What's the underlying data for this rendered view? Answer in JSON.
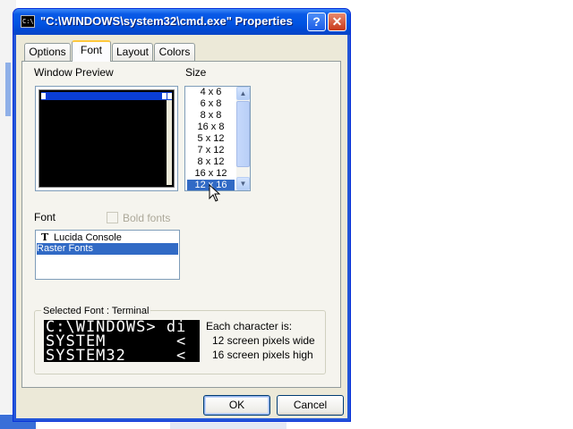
{
  "window": {
    "title": "\"C:\\WINDOWS\\system32\\cmd.exe\" Properties",
    "icon_text": "C:\\",
    "help_label": "?",
    "close_label": "✕"
  },
  "tabs": [
    {
      "label": "Options"
    },
    {
      "label": "Font"
    },
    {
      "label": "Layout"
    },
    {
      "label": "Colors"
    }
  ],
  "font_tab": {
    "window_preview_label": "Window Preview",
    "size_label": "Size",
    "sizes": [
      "4 x 6",
      "6 x 8",
      "8 x 8",
      "16 x 8",
      "5 x 12",
      "7 x 12",
      "8 x 12",
      "16 x 12",
      "12 x 16"
    ],
    "selected_size": "12 x 16",
    "font_label": "Font",
    "bold_fonts_label": "Bold fonts",
    "bold_fonts_checked": false,
    "fonts": [
      {
        "name": "Lucida Console",
        "icon": "truetype-icon",
        "selected": false
      },
      {
        "name": "Raster Fonts",
        "icon": "",
        "selected": true
      }
    ],
    "selected_font_label": "Selected Font : Terminal",
    "sample_lines": [
      "C:\\WINDOWS> di",
      "SYSTEM       <",
      "SYSTEM32     <"
    ],
    "info_heading": "Each character is:",
    "info_width": "12 screen pixels wide",
    "info_height": "16 screen pixels high"
  },
  "buttons": {
    "ok": "OK",
    "cancel": "Cancel"
  },
  "colors": {
    "title_blue": "#0054e3",
    "selection": "#316ac5",
    "dialog_bg": "#ece9d8"
  }
}
